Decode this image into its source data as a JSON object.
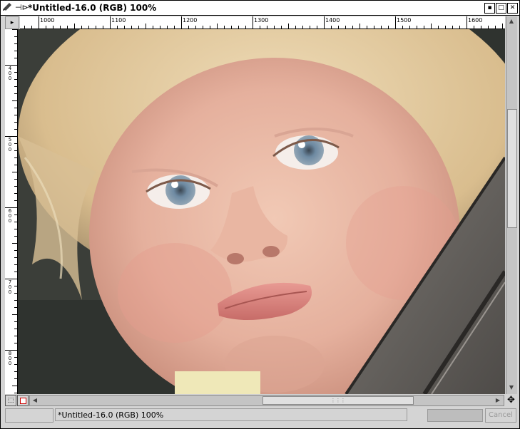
{
  "window": {
    "title": "*Untitled-16.0 (RGB) 100%",
    "menu_icon": "pencil-icon",
    "pin_glyph": "⊣⊳",
    "buttons": {
      "minimize": "▪",
      "maximize": "□",
      "close": "✕"
    }
  },
  "rulers": {
    "horizontal_labels": [
      "1000",
      "1100",
      "1200",
      "1300",
      "1400",
      "1500",
      "1600"
    ],
    "vertical_labels": [
      "400",
      "500",
      "600",
      "700",
      "800"
    ]
  },
  "statusbar": {
    "text": "*Untitled-16.0 (RGB) 100%",
    "cancel_label": "Cancel"
  },
  "colors": {
    "title_bg": "#ffffff",
    "chrome": "#d4d4d4"
  }
}
